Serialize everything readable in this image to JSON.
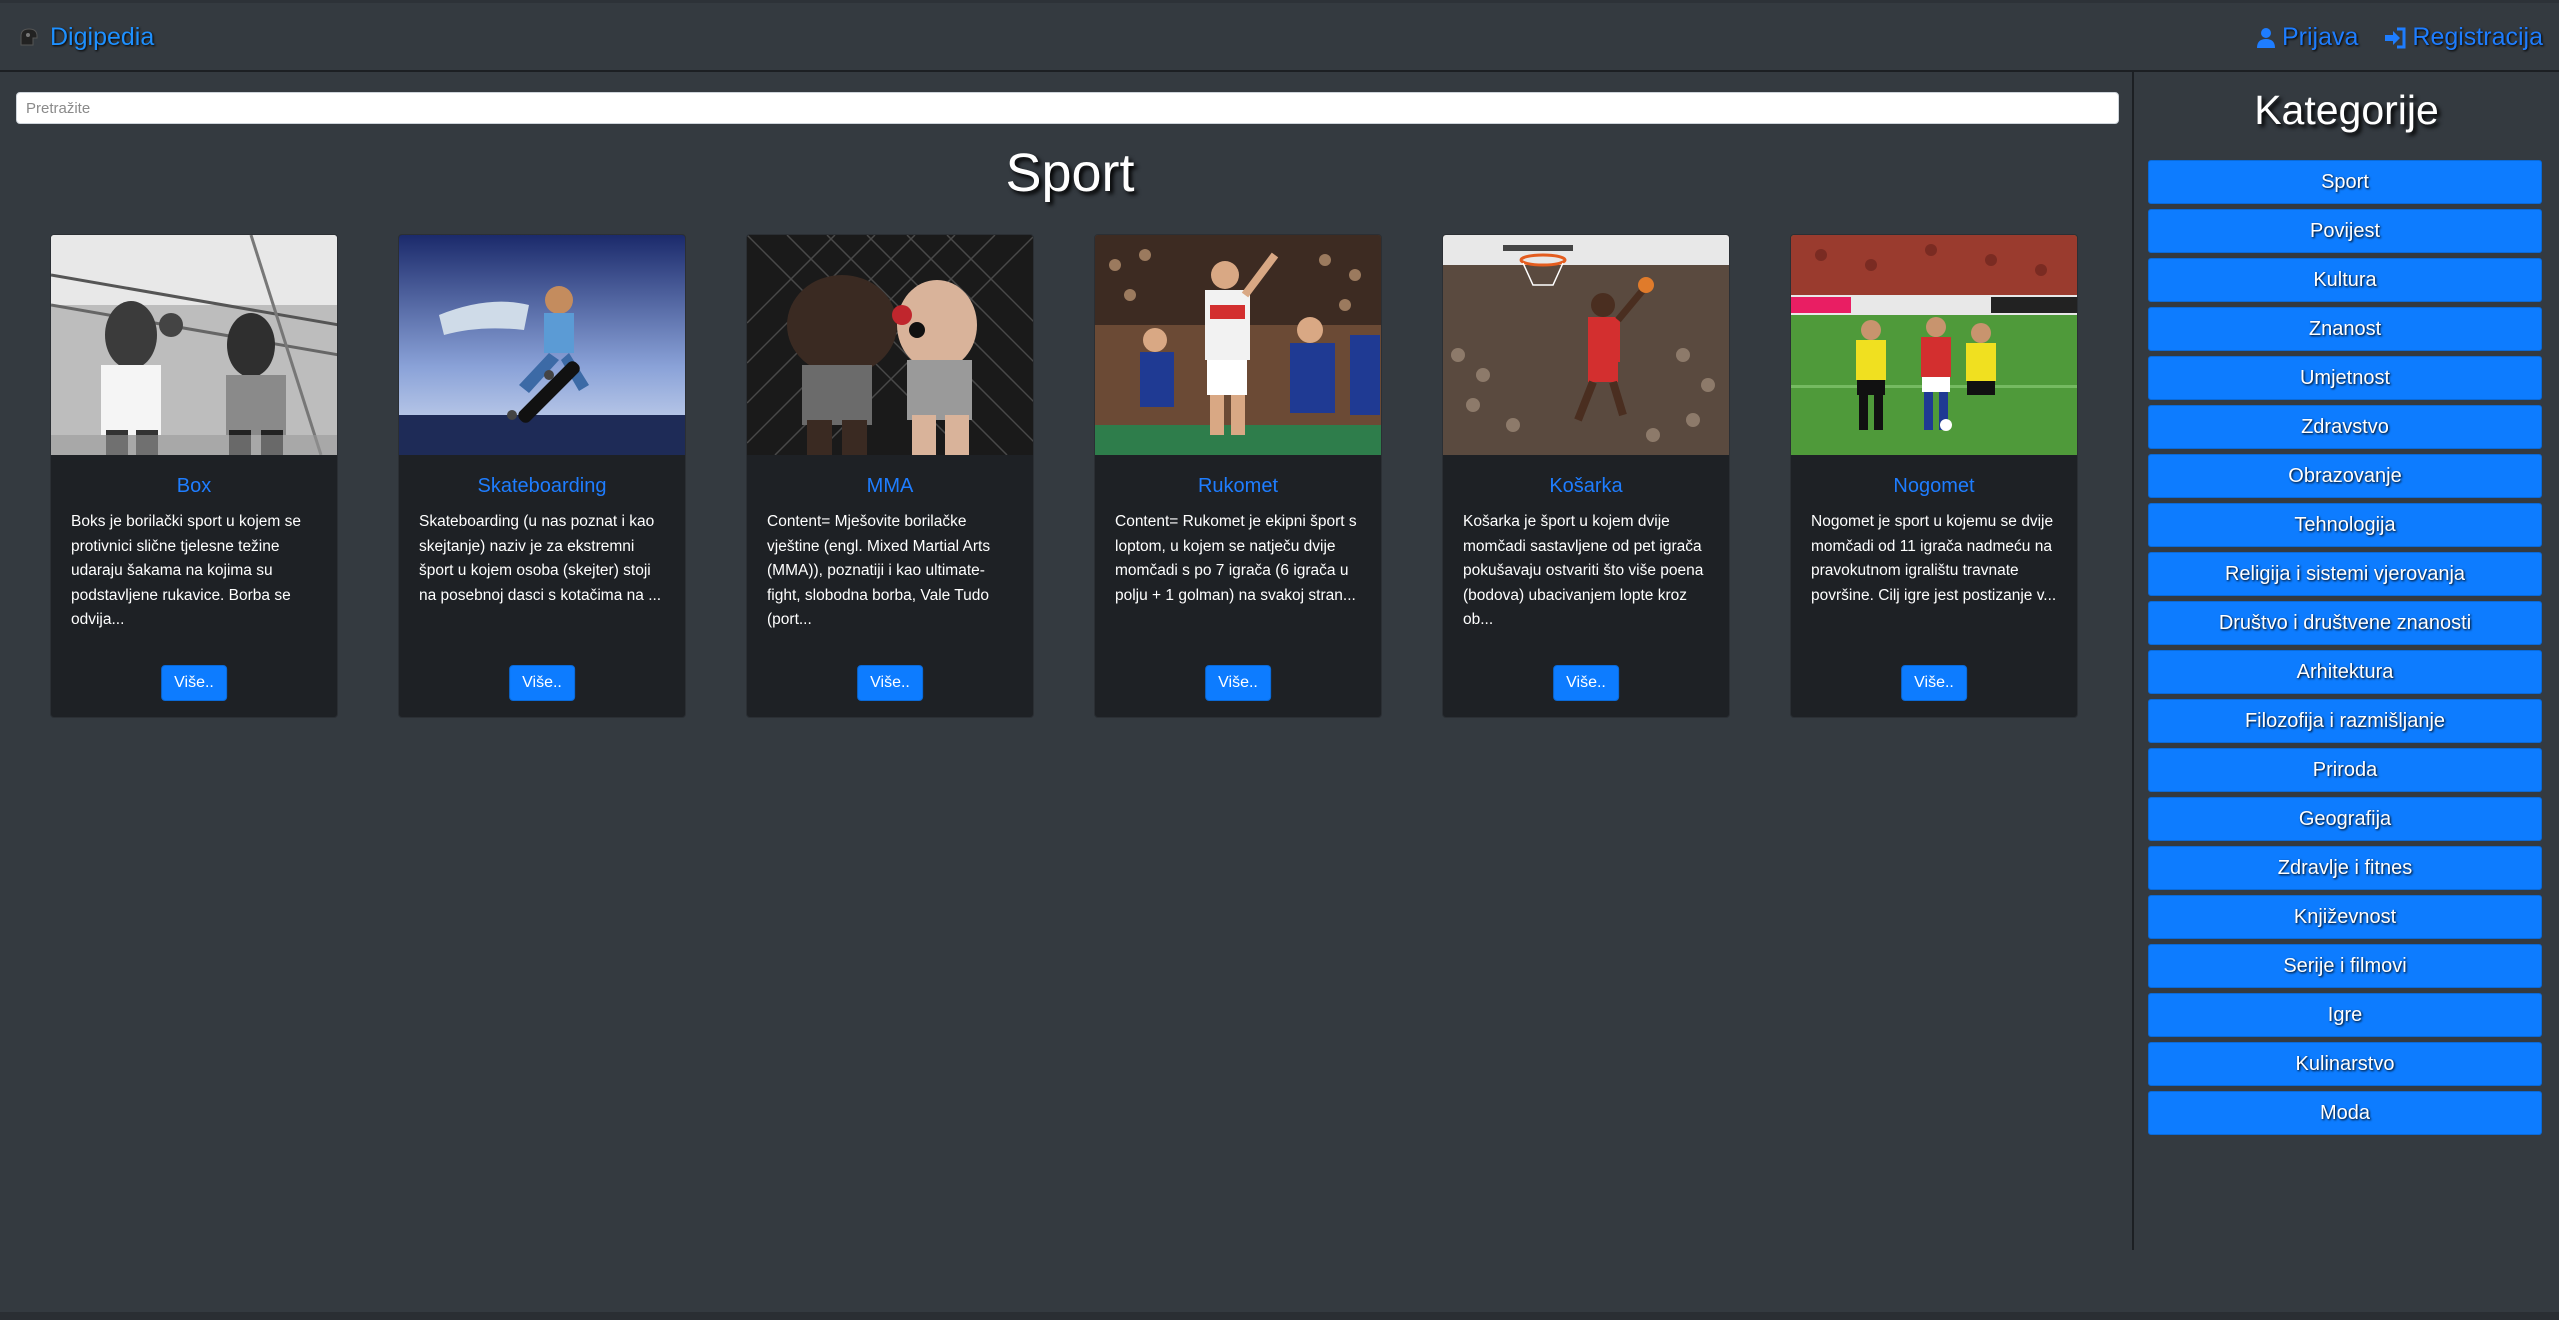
{
  "header": {
    "brand": "Digipedia",
    "login": "Prijava",
    "register": "Registracija"
  },
  "search": {
    "placeholder": "Pretražite"
  },
  "page_title": "Sport",
  "cards": [
    {
      "title": "Box",
      "text": "Boks je borilački sport u kojem se protivnici slične tjelesne težine udaraju šakama na kojima su podstavljene rukavice. Borba se odvija...",
      "button": "Više.."
    },
    {
      "title": "Skateboarding",
      "text": "Skateboarding (u nas poznat i kao skejtanje) naziv je za ekstremni šport u kojem osoba (skejter) stoji na posebnoj dasci s kotačima na ...",
      "button": "Više.."
    },
    {
      "title": "MMA",
      "text": "Content= Mješovite borilačke vještine (engl. Mixed Martial Arts (MMA)), poznatiji i kao ultimate-fight, slobodna borba, Vale Tudo (port...",
      "button": "Više.."
    },
    {
      "title": "Rukomet",
      "text": "Content= Rukomet je ekipni šport s loptom, u kojem se natječu dvije momčadi s po 7 igrača (6 igrača u polju + 1 golman) na svakoj stran...",
      "button": "Više.."
    },
    {
      "title": "Košarka",
      "text": "Košarka je šport u kojem dvije momčadi sastavljene od pet igrača pokušavaju ostvariti što više poena (bodova) ubacivanjem lopte kroz ob...",
      "button": "Više.."
    },
    {
      "title": "Nogomet",
      "text": "Nogomet je sport u kojemu se dvije momčadi od 11 igrača nadmeću na pravokutnom igralištu travnate površine. Cilj igre jest postizanje v...",
      "button": "Više.."
    }
  ],
  "sidebar": {
    "title": "Kategorije",
    "categories": [
      "Sport",
      "Povijest",
      "Kultura",
      "Znanost",
      "Umjetnost",
      "Zdravstvo",
      "Obrazovanje",
      "Tehnologija",
      "Religija i sistemi vjerovanja",
      "Društvo i društvene znanosti",
      "Arhitektura",
      "Filozofija i razmišljanje",
      "Priroda",
      "Geografija",
      "Zdravlje i fitnes",
      "Književnost",
      "Serije i filmovi",
      "Igre",
      "Kulinarstvo",
      "Moda"
    ]
  },
  "colors": {
    "background": "#343a40",
    "accent": "#0d7cff",
    "card": "#1e2125"
  },
  "icons": {
    "brand": "logo-icon",
    "login": "user-icon",
    "register": "sign-in-icon"
  }
}
